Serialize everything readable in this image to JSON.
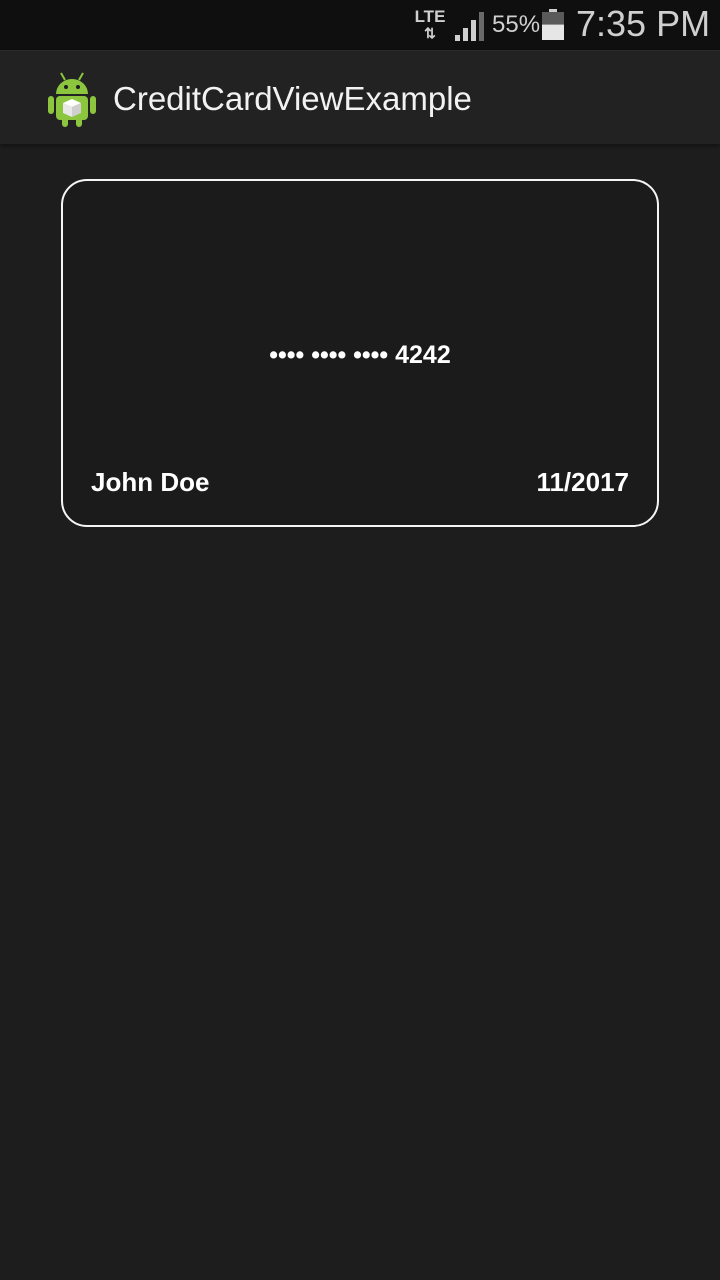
{
  "status_bar": {
    "network_label": "LTE",
    "network_arrows": "⇅",
    "signal_icon": "signal-bars-icon",
    "battery_percent": "55%",
    "battery_icon": "battery-icon",
    "battery_level": 0.55,
    "time": "7:35 PM"
  },
  "action_bar": {
    "app_icon": "android-app-icon",
    "title": "CreditCardViewExample"
  },
  "credit_card": {
    "number": "•••• •••• •••• 4242",
    "holder_name": "John Doe",
    "expiry": "11/2017"
  },
  "colors": {
    "background": "#1d1d1d",
    "status_bar": "#0f0f0f",
    "action_bar": "#222222",
    "card_border": "#f5f5f5",
    "text": "#ffffff",
    "android_green": "#8cc63f"
  }
}
